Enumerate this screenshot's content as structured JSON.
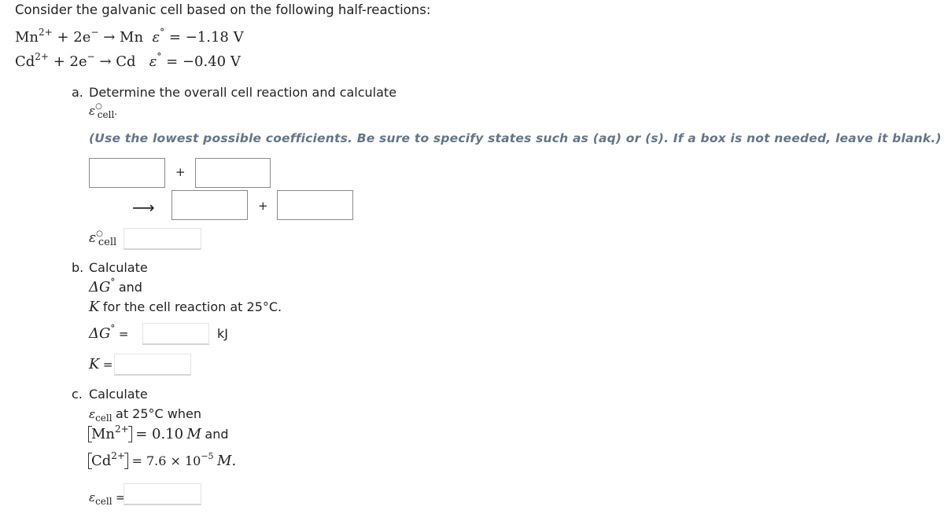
{
  "intro": "Consider the galvanic cell based on the following half-reactions:",
  "half_reactions": [
    {
      "ion": "Mn",
      "charge": "2+",
      "electrons": "+ 2e",
      "electron_sup": "−",
      "arrow": "→",
      "product": "Mn",
      "symbol": "ε",
      "deg": "°",
      "value": "= −1.18 V"
    },
    {
      "ion": "Cd",
      "charge": "2+",
      "electrons": "+ 2e",
      "electron_sup": "−",
      "arrow": "→",
      "product": "Cd",
      "symbol": "ε",
      "deg": "°",
      "value": "= −0.40 V"
    }
  ],
  "part_a": {
    "marker": "a.",
    "prompt": "Determine the overall cell reaction and calculate",
    "ecell_symbol": "ε",
    "ecell_sup": "○",
    "ecell_sub": "cell",
    "period": ".",
    "hint": "(Use the lowest possible coefficients. Be sure to specify states such as (aq) or (s). If a box is not needed, leave it blank.)",
    "plus": "+",
    "arrow": "⟶",
    "reactant_1": "",
    "reactant_2": "",
    "product_1": "",
    "product_2": "",
    "ecell_label_eq": "=",
    "ecell_value": ""
  },
  "part_b": {
    "marker": "b.",
    "line1": "Calculate",
    "dg_symbol": "ΔG",
    "deg": "°",
    "and": "and",
    "k_symbol": "K",
    "line3": "for the cell reaction at 25°C.",
    "eq": "=",
    "dg_value": "",
    "dg_unit": "kJ",
    "k_value": ""
  },
  "part_c": {
    "marker": "c.",
    "line1": "Calculate",
    "ecell_symbol": "ε",
    "ecell_sub": "cell",
    "line2": "at 25°C when",
    "mn_ion": "Mn",
    "mn_charge": "2+",
    "mn_conc": "= 0.10",
    "mn_unit": "M",
    "and": "and",
    "cd_ion": "Cd",
    "cd_charge": "2+",
    "cd_conc": "= 7.6 × 10",
    "cd_exp": "−5",
    "cd_unit": "M",
    "period": ".",
    "eq": "=",
    "ecell_value": ""
  }
}
